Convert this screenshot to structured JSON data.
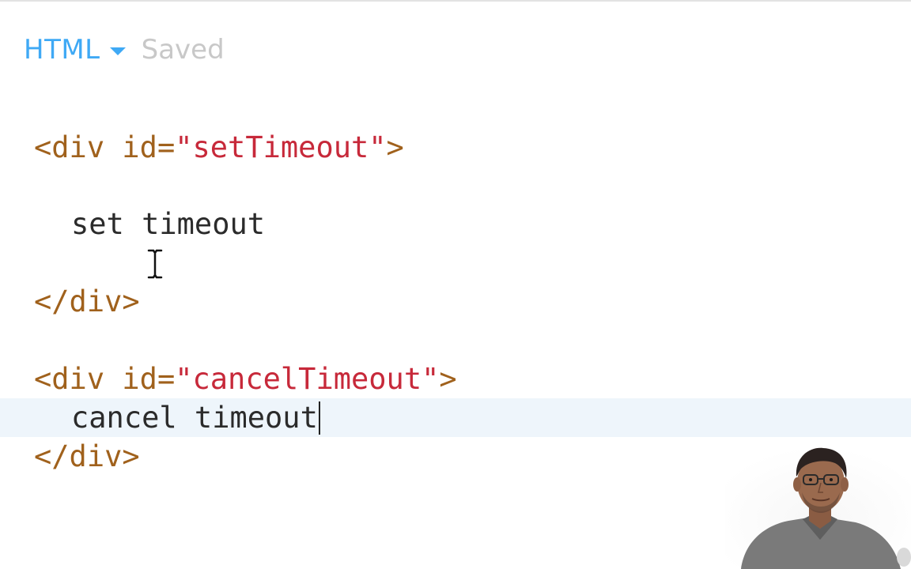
{
  "header": {
    "language": "HTML",
    "status": "Saved"
  },
  "code": {
    "line1": {
      "open": "<",
      "tag": "div",
      "space": " ",
      "attr": "id",
      "eq": "=",
      "value": "\"setTimeout\"",
      "close": ">"
    },
    "line2": {
      "text": "set timeout"
    },
    "line3": {
      "text": "</div>"
    },
    "line4": {
      "open": "<",
      "tag": "div",
      "space": " ",
      "attr": "id",
      "eq": "=",
      "value": "\"cancelTimeout\"",
      "close": ">"
    },
    "line5": {
      "text": "cancel timeout"
    },
    "line6": {
      "text": "</div>"
    }
  },
  "icons": {
    "dropdown": "caret-down-icon",
    "mouse": "text-cursor-icon"
  },
  "colors": {
    "accent": "#3fa9f5",
    "status": "#c8c8c8",
    "tag": "#a0611c",
    "string": "#c7293a",
    "active_line": "#eef5fb"
  }
}
